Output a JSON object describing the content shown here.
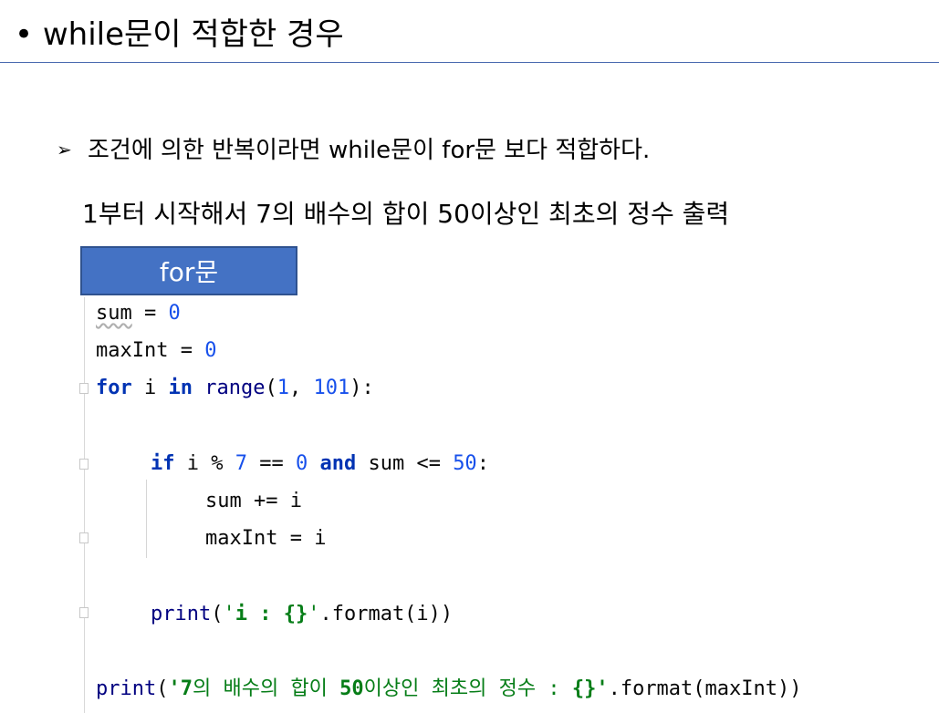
{
  "slide": {
    "title": "• while문이 적합한 경우",
    "bullet_marker": "➢",
    "bullet_text": "조건에 의한 반복이라면 while문이 for문 보다 적합하다.",
    "sub_text": "1부터 시작해서 7의 배수의 합이 50이상인 최초의 정수 출력",
    "badge_label": "for문",
    "badge_color": "#4472c4",
    "rule_color": "#4a6ab0"
  },
  "code": {
    "line1": {
      "var": "sum",
      "op": " = ",
      "num": "0"
    },
    "line2": {
      "var": "maxInt",
      "op": " = ",
      "num": "0"
    },
    "line3": {
      "kw_for": "for",
      "sp1": " i ",
      "kw_in": "in",
      "sp2": " ",
      "fn": "range",
      "open": "(",
      "a": "1",
      "comma": ", ",
      "b": "101",
      "close": "):"
    },
    "line5": {
      "kw_if": "if",
      "t1": " i % ",
      "n7": "7",
      "t2": " == ",
      "n0": "0",
      "sp": " ",
      "kw_and": "and",
      "t3": " sum <= ",
      "n50": "50",
      "colon": ":"
    },
    "line6": {
      "text": "sum += i"
    },
    "line7": {
      "text": "maxInt = i"
    },
    "line9": {
      "fn": "print",
      "open": "(",
      "s1": "'",
      "sb": "i : {}",
      "s2": "'",
      "rest": ".format(i))"
    },
    "line11": {
      "fn": "print",
      "open": "(",
      "q1": "'",
      "b7": "7",
      "s1": "의 배수의 합이 ",
      "b50": "50",
      "s2": "이상인 최초의 정수 : ",
      "bbr": "{}",
      "q2": "'",
      "rest": ".format(maxInt))"
    }
  },
  "colors": {
    "keyword": "#0033b3",
    "number": "#1750eb",
    "string": "#067d17",
    "function": "#000080"
  }
}
